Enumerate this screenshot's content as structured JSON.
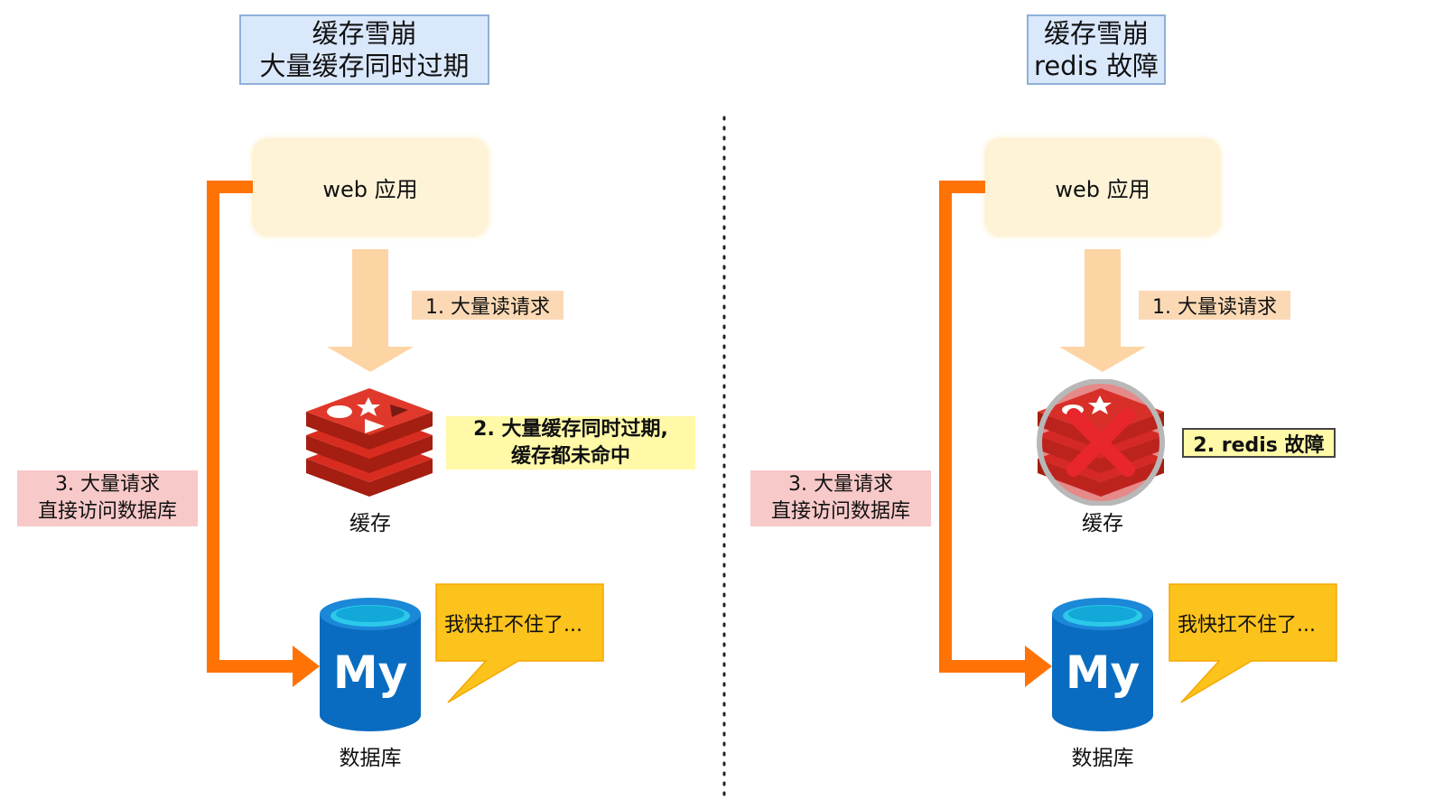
{
  "left": {
    "title_line1": "缓存雪崩",
    "title_line2": "大量缓存同时过期",
    "web_label": "web 应用",
    "step1": "1. 大量读请求",
    "step2_line1": "2. 大量缓存同时过期,",
    "step2_line2": "缓存都未命中",
    "step3_line1": "3. 大量请求",
    "step3_line2": "直接访问数据库",
    "cache_label": "缓存",
    "db_label": "数据库",
    "bubble": "我快扛不住了..."
  },
  "right": {
    "title_line1": "缓存雪崩",
    "title_line2": "redis 故障",
    "web_label": "web 应用",
    "step1": "1. 大量读请求",
    "step2": "2. redis 故障",
    "step3_line1": "3. 大量请求",
    "step3_line2": "直接访问数据库",
    "cache_label": "缓存",
    "db_label": "数据库",
    "bubble": "我快扛不住了..."
  },
  "mysql_logo_text": "My",
  "colors": {
    "title_fill": "#dae8fc",
    "web_fill": "#fef3d7",
    "request_arrow": "#fdd4a3",
    "db_path_arrow": "#ff7306",
    "redis_red": "#d82c20",
    "mysql_blue": "#0a6cc0",
    "bubble_fill": "#fcc31d",
    "error_x": "#e8262c"
  }
}
